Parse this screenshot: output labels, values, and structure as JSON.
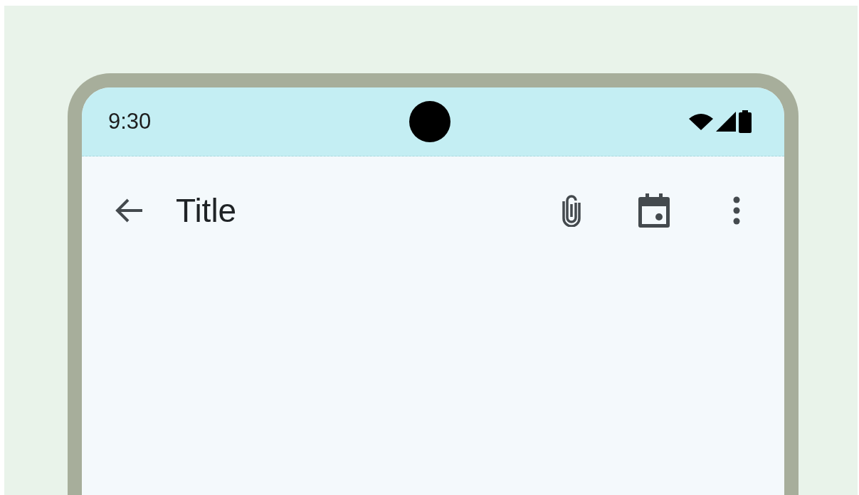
{
  "status_bar": {
    "time": "9:30"
  },
  "app_bar": {
    "title": "Title"
  }
}
